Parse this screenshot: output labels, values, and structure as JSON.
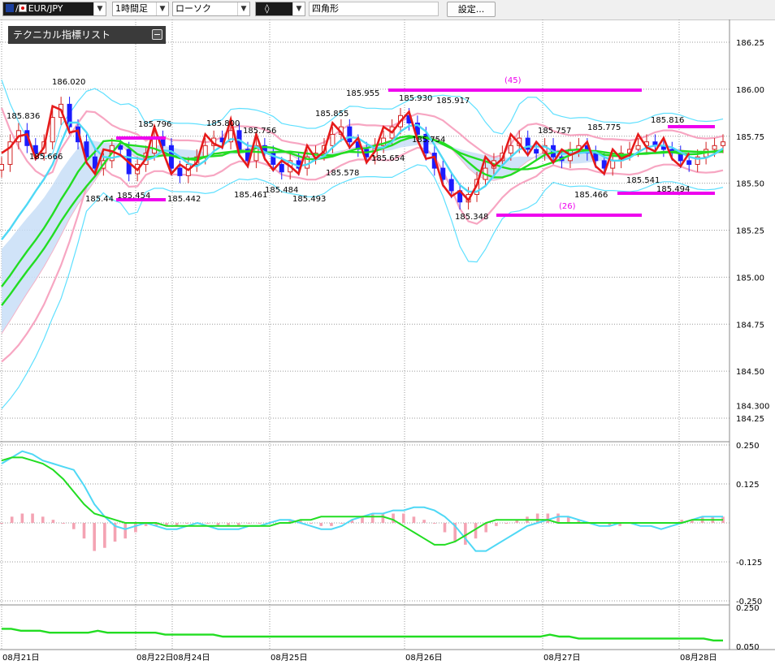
{
  "toolbar": {
    "symbol": "EUR/JPY",
    "timeframe": "1時間足",
    "chart_type": "ローソク",
    "draw_tool": "◊",
    "shape": "四角形",
    "settings_label": "設定..."
  },
  "indicator_panel": {
    "title": "テクニカル指標リスト"
  },
  "chart_data": [
    {
      "type": "candlestick",
      "panel": "main",
      "symbol": "EUR/JPY",
      "timeframe": "1時間足",
      "y_ticks": [
        "186.25",
        "186.00",
        "185.75",
        "185.50",
        "185.25",
        "185.00",
        "184.75",
        "184.50",
        "184.300",
        "184.25"
      ],
      "ylim": [
        184.25,
        186.25
      ],
      "x_ticks": [
        "08月21日",
        "08月22日",
        "08月24日",
        "08月25日",
        "08月26日",
        "08月27日",
        "08月28日"
      ],
      "price_labels": [
        "186.020",
        "185.836",
        "185.666",
        "185.44",
        "185.454",
        "185.796",
        "185.442",
        "185.800",
        "185.756",
        "185.461",
        "185.484",
        "185.493",
        "185.855",
        "185.578",
        "185.955",
        "185.930",
        "185.917",
        "185.654",
        "185.754",
        "185.348",
        "185.757",
        "185.775",
        "185.466",
        "185.541",
        "185.816",
        "185.494"
      ],
      "annotations": [
        "(45)",
        "(26)"
      ],
      "series": [
        {
          "name": "close",
          "values": [
            185.6,
            185.72,
            185.78,
            185.7,
            185.66,
            185.72,
            185.85,
            185.92,
            185.8,
            185.72,
            185.64,
            185.58,
            185.62,
            185.7,
            185.68,
            185.55,
            185.6,
            185.66,
            185.74,
            185.7,
            185.58,
            185.54,
            185.6,
            185.64,
            185.7,
            185.74,
            185.72,
            185.78,
            185.68,
            185.62,
            185.7,
            185.66,
            185.6,
            185.56,
            185.62,
            185.58,
            185.64,
            185.66,
            185.7,
            185.76,
            185.8,
            185.72,
            185.68,
            185.64,
            185.7,
            185.74,
            185.8,
            185.86,
            185.82,
            185.76,
            185.66,
            185.58,
            185.52,
            185.46,
            185.4,
            185.44,
            185.52,
            185.58,
            185.62,
            185.66,
            185.7,
            185.74,
            185.68,
            185.66,
            185.7,
            185.64,
            185.62,
            185.68,
            185.7,
            185.66,
            185.62,
            185.58,
            185.62,
            185.66,
            185.68,
            185.7,
            185.72,
            185.7,
            185.68,
            185.66,
            185.62,
            185.6,
            185.64,
            185.68,
            185.7,
            185.72
          ]
        }
      ]
    },
    {
      "type": "line",
      "panel": "oscillator",
      "y_ticks": [
        "0.250",
        "0.125",
        "-0.125",
        "-0.250"
      ],
      "ylim": [
        -0.25,
        0.25
      ],
      "series": [
        {
          "values": [
            0.19,
            0.21,
            0.23,
            0.22,
            0.2,
            0.19,
            0.18,
            0.17,
            0.12,
            0.06,
            0.02,
            -0.01,
            -0.02,
            -0.01,
            0.0,
            -0.01,
            -0.02,
            -0.02,
            -0.01,
            0.0,
            -0.01,
            -0.02,
            -0.02,
            -0.02,
            -0.01,
            -0.01,
            0.0,
            0.01,
            0.01,
            0.0,
            -0.01,
            -0.02,
            -0.02,
            -0.01,
            0.01,
            0.02,
            0.03,
            0.03,
            0.04,
            0.04,
            0.05,
            0.05,
            0.04,
            0.02,
            -0.01,
            -0.05,
            -0.09,
            -0.09,
            -0.07,
            -0.05,
            -0.03,
            -0.01,
            0.0,
            0.01,
            0.02,
            0.02,
            0.01,
            0.0,
            -0.01,
            -0.01,
            0.0,
            0.0,
            -0.01,
            -0.01,
            -0.02,
            -0.01,
            0.0,
            0.01,
            0.02,
            0.02,
            0.02
          ]
        },
        {
          "values": [
            0.2,
            0.21,
            0.21,
            0.2,
            0.19,
            0.17,
            0.14,
            0.1,
            0.06,
            0.03,
            0.02,
            0.01,
            0.0,
            0.0,
            0.0,
            0.0,
            -0.01,
            -0.01,
            -0.01,
            -0.01,
            -0.01,
            -0.01,
            -0.01,
            -0.01,
            -0.01,
            -0.01,
            -0.01,
            0.0,
            0.0,
            0.01,
            0.01,
            0.02,
            0.02,
            0.02,
            0.02,
            0.02,
            0.02,
            0.02,
            0.01,
            -0.01,
            -0.03,
            -0.05,
            -0.07,
            -0.07,
            -0.06,
            -0.04,
            -0.02,
            0.0,
            0.01,
            0.01,
            0.01,
            0.01,
            0.01,
            0.01,
            0.0,
            0.0,
            0.0,
            0.0,
            0.0,
            0.0,
            0.0,
            0.0,
            0.0,
            0.0,
            0.0,
            0.0,
            0.0,
            0.01,
            0.01,
            0.01,
            0.01
          ]
        },
        {
          "values": [
            0.0,
            0.02,
            0.03,
            0.03,
            0.02,
            0.01,
            0.0,
            -0.02,
            -0.05,
            -0.09,
            -0.08,
            -0.06,
            -0.05,
            -0.03,
            -0.01,
            -0.01,
            -0.01,
            -0.01,
            0.0,
            0.0,
            0.0,
            -0.01,
            -0.01,
            -0.01,
            0.0,
            0.0,
            0.0,
            0.0,
            0.01,
            0.01,
            0.0,
            -0.01,
            -0.01,
            0.0,
            0.01,
            0.02,
            0.03,
            0.03,
            0.03,
            0.03,
            0.02,
            0.01,
            0.0,
            -0.03,
            -0.06,
            -0.07,
            -0.05,
            -0.03,
            -0.01,
            0.0,
            0.01,
            0.02,
            0.03,
            0.03,
            0.03,
            0.02,
            0.01,
            0.0,
            0.0,
            -0.01,
            -0.01,
            0.0,
            0.0,
            0.0,
            0.0,
            0.0,
            0.01,
            0.01,
            0.02,
            0.02,
            0.02
          ]
        }
      ]
    },
    {
      "type": "line",
      "panel": "lower",
      "y_ticks": [
        "0.250",
        "0.050"
      ],
      "ylim": [
        0.05,
        0.25
      ],
      "series": [
        {
          "values": [
            0.14,
            0.14,
            0.13,
            0.13,
            0.13,
            0.12,
            0.12,
            0.12,
            0.12,
            0.12,
            0.13,
            0.12,
            0.12,
            0.12,
            0.12,
            0.12,
            0.12,
            0.11,
            0.11,
            0.11,
            0.11,
            0.11,
            0.11,
            0.1,
            0.1,
            0.1,
            0.1,
            0.1,
            0.1,
            0.1,
            0.1,
            0.1,
            0.1,
            0.1,
            0.1,
            0.1,
            0.1,
            0.1,
            0.1,
            0.1,
            0.1,
            0.1,
            0.1,
            0.1,
            0.1,
            0.1,
            0.1,
            0.1,
            0.1,
            0.1,
            0.1,
            0.1,
            0.1,
            0.1,
            0.1,
            0.1,
            0.1,
            0.11,
            0.1,
            0.1,
            0.09,
            0.09,
            0.09,
            0.09,
            0.09,
            0.09,
            0.09,
            0.09,
            0.09,
            0.09,
            0.09,
            0.09,
            0.09,
            0.09,
            0.08,
            0.08
          ]
        }
      ]
    }
  ]
}
